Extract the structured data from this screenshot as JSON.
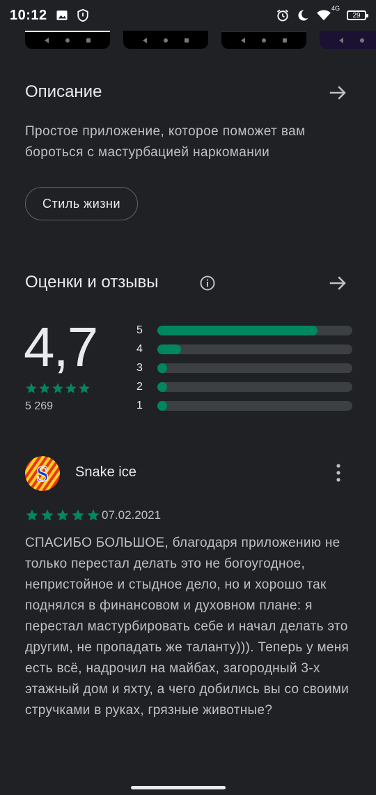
{
  "status_bar": {
    "time": "10:12",
    "network": "4G",
    "battery": "29"
  },
  "description": {
    "title": "Описание",
    "text": "Простое приложение, которое поможет вам бороться с мастурбацией наркомании",
    "chip": "Стиль жизни"
  },
  "ratings": {
    "title": "Оценки и отзывы",
    "score": "4,7",
    "count": "5 269",
    "stars": 4.7,
    "distribution": [
      {
        "label": "5",
        "fraction": 0.82
      },
      {
        "label": "4",
        "fraction": 0.12
      },
      {
        "label": "3",
        "fraction": 0.05
      },
      {
        "label": "2",
        "fraction": 0.05
      },
      {
        "label": "1",
        "fraction": 0.05
      }
    ]
  },
  "review": {
    "author": "Snake ice",
    "avatar_letter": "S",
    "stars": 5,
    "date": "07.02.2021",
    "text": "СПАСИБО БОЛЬШОЕ, благодаря приложению не только перестал делать это не богоугодное, непристойное и стыдное дело, но и хорошо так поднялся в финансовом и духовном плане: я перестал мастурбировать себе и начал делать это другим, не пропадать же таланту))). Теперь у меня есть всё, надрочил на майбах, загородный 3-х этажный дом и яхту, а чего добились вы со своими стручками в руках, грязные животные?"
  },
  "colors": {
    "accent": "#01875f",
    "background": "#202124",
    "track": "#3c4043"
  },
  "icons": [
    "image-icon",
    "shield-icon",
    "alarm-icon",
    "moon-icon",
    "wifi-icon",
    "battery-icon",
    "arrow-right-icon",
    "info-icon",
    "more-vert-icon",
    "star-icon"
  ]
}
